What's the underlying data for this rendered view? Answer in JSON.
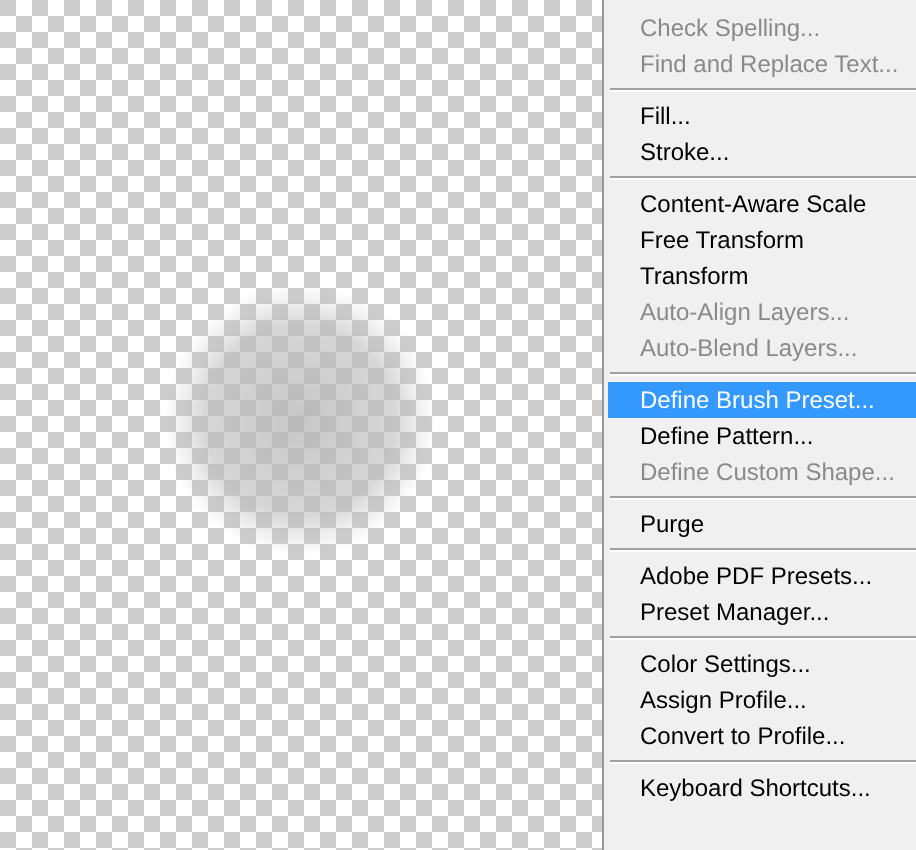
{
  "canvas": {
    "kind": "transparent"
  },
  "menu": {
    "sections": [
      {
        "items": [
          {
            "label": "Check Spelling...",
            "disabled": true,
            "selected": false
          },
          {
            "label": "Find and Replace Text...",
            "disabled": true,
            "selected": false
          }
        ]
      },
      {
        "items": [
          {
            "label": "Fill...",
            "disabled": false,
            "selected": false
          },
          {
            "label": "Stroke...",
            "disabled": false,
            "selected": false
          }
        ]
      },
      {
        "items": [
          {
            "label": "Content-Aware Scale",
            "disabled": false,
            "selected": false
          },
          {
            "label": "Free Transform",
            "disabled": false,
            "selected": false
          },
          {
            "label": "Transform",
            "disabled": false,
            "selected": false
          },
          {
            "label": "Auto-Align Layers...",
            "disabled": true,
            "selected": false
          },
          {
            "label": "Auto-Blend Layers...",
            "disabled": true,
            "selected": false
          }
        ]
      },
      {
        "items": [
          {
            "label": "Define Brush Preset...",
            "disabled": false,
            "selected": true
          },
          {
            "label": "Define Pattern...",
            "disabled": false,
            "selected": false
          },
          {
            "label": "Define Custom Shape...",
            "disabled": true,
            "selected": false
          }
        ]
      },
      {
        "items": [
          {
            "label": "Purge",
            "disabled": false,
            "selected": false
          }
        ]
      },
      {
        "items": [
          {
            "label": "Adobe PDF Presets...",
            "disabled": false,
            "selected": false
          },
          {
            "label": "Preset Manager...",
            "disabled": false,
            "selected": false
          }
        ]
      },
      {
        "items": [
          {
            "label": "Color Settings...",
            "disabled": false,
            "selected": false
          },
          {
            "label": "Assign Profile...",
            "disabled": false,
            "selected": false
          },
          {
            "label": "Convert to Profile...",
            "disabled": false,
            "selected": false
          }
        ]
      },
      {
        "items": [
          {
            "label": "Keyboard Shortcuts...",
            "disabled": false,
            "selected": false
          }
        ]
      }
    ]
  }
}
